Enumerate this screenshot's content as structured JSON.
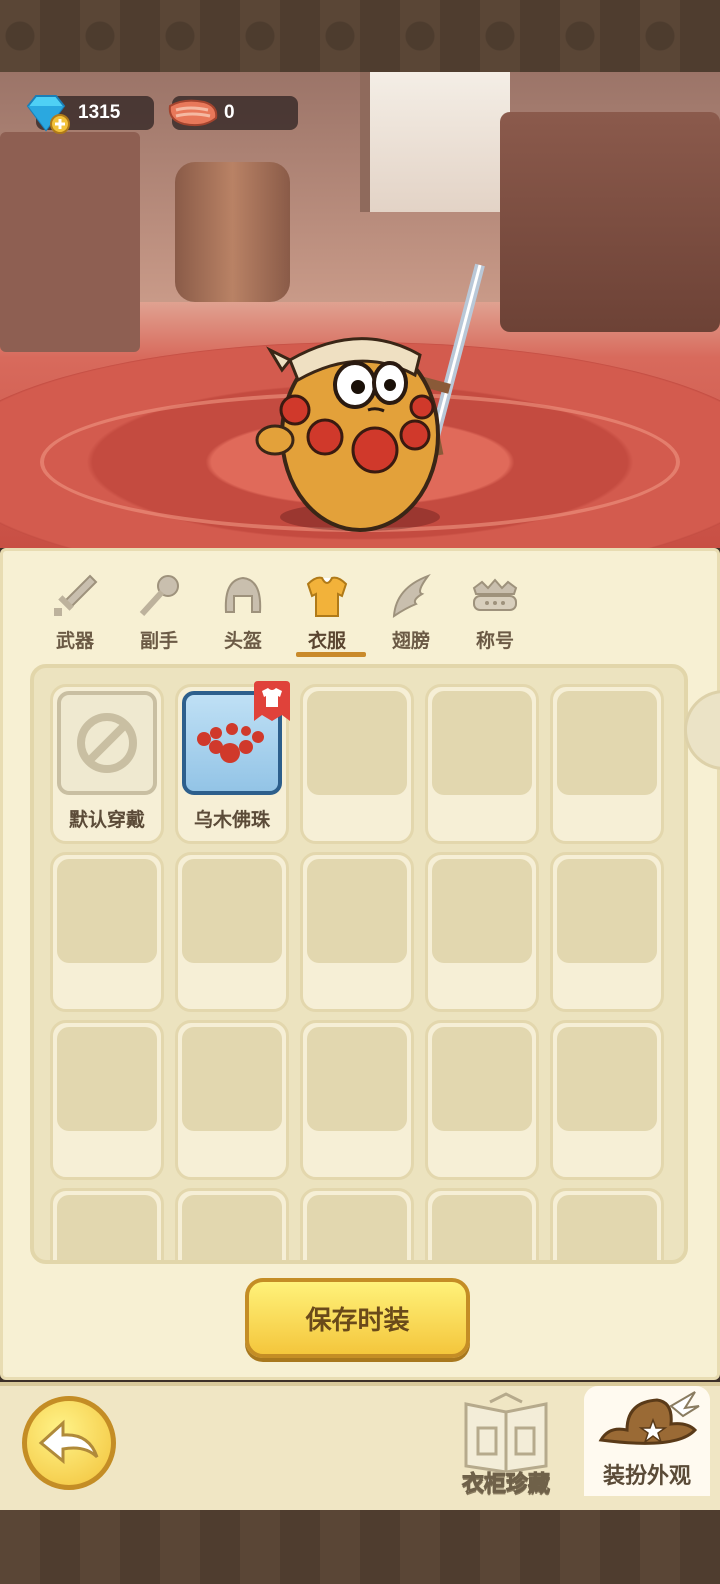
{
  "currencies": {
    "gems": "1315",
    "meat": "0"
  },
  "tabs": [
    {
      "label": "武器",
      "icon": "sword-icon",
      "active": false
    },
    {
      "label": "副手",
      "icon": "offhand-icon",
      "active": false
    },
    {
      "label": "头盔",
      "icon": "helmet-icon",
      "active": false
    },
    {
      "label": "衣服",
      "icon": "armor-icon",
      "active": true
    },
    {
      "label": "翅膀",
      "icon": "wings-icon",
      "active": false
    },
    {
      "label": "称号",
      "icon": "title-badge-icon",
      "active": false
    }
  ],
  "slots": {
    "default_label": "默认穿戴",
    "item_label": "乌木佛珠"
  },
  "save_button": "保存时装",
  "bottom_nav": {
    "wardrobe": "衣柜珍藏",
    "dressup": "装扮外观"
  },
  "colors": {
    "accent": "#c98a2b",
    "panel": "#f7f0d3",
    "button": "#f4c63c"
  }
}
